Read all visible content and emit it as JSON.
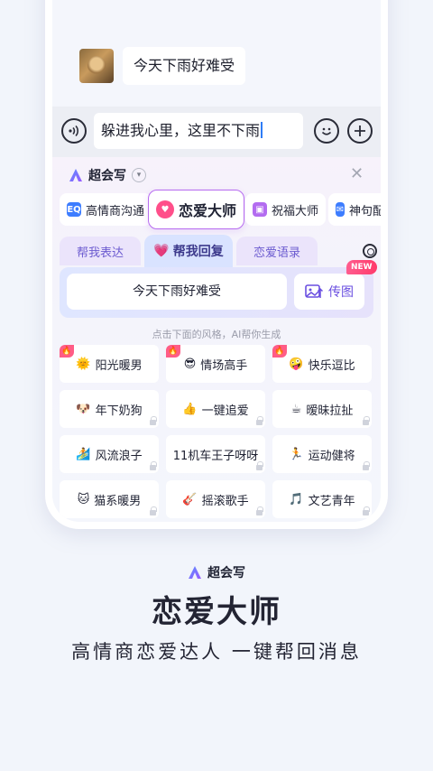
{
  "chat": {
    "received_message": "今天下雨好难受"
  },
  "input": {
    "value": "躲进我心里，这里不下雨"
  },
  "panel": {
    "brand": "超会写",
    "tools": [
      {
        "label": "高情商沟通",
        "icon": "eq-icon"
      },
      {
        "label": "恋爱大师",
        "icon": "heart-chat-icon"
      },
      {
        "label": "祝福大师",
        "icon": "gift-icon"
      },
      {
        "label": "神句配",
        "icon": "mail-icon"
      }
    ],
    "tabs": [
      "帮我表达",
      "帮我回复",
      "恋爱语录"
    ],
    "reply_source": "今天下雨好难受",
    "image_button": "传图",
    "new_badge": "NEW",
    "hint": "点击下面的风格，AI帮你生成",
    "styles": [
      {
        "emoji": "🌞",
        "label": "阳光暖男"
      },
      {
        "emoji": "😎",
        "label": "情场高手"
      },
      {
        "emoji": "🤪",
        "label": "快乐逗比"
      },
      {
        "emoji": "🐶",
        "label": "年下奶狗"
      },
      {
        "emoji": "👍",
        "label": "一键追爱"
      },
      {
        "emoji": "☕",
        "label": "暧昧拉扯"
      },
      {
        "emoji": "🏄",
        "label": "风流浪子"
      },
      {
        "emoji": "",
        "label": "11机车王子呀呀"
      },
      {
        "emoji": "🏃",
        "label": "运动健将"
      },
      {
        "emoji": "🐱",
        "label": "猫系暖男"
      },
      {
        "emoji": "🎸",
        "label": "摇滚歌手"
      },
      {
        "emoji": "🎵",
        "label": "文艺青年"
      }
    ]
  },
  "footer": {
    "brand": "超会写",
    "title": "恋爱大师",
    "subtitle": "高情商恋爱达人 一键帮回消息"
  },
  "colors": {
    "accent": "#6a4fe0",
    "active_border": "#b76cf0",
    "hot_badge": "#ff5c86"
  }
}
